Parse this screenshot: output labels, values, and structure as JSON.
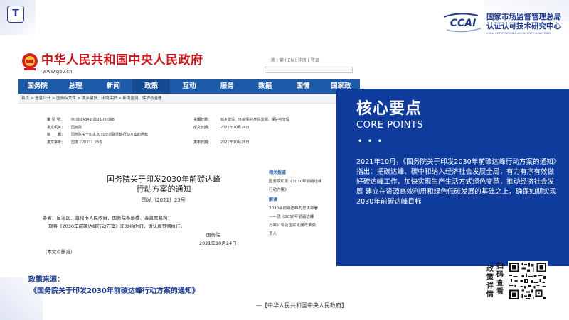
{
  "logo": {
    "mark": "CCAI",
    "name_line1": "国家市场监督管理总局",
    "name_line2": "认证认可技术研究中心",
    "name_en": "CHINA CERTIFICATION & ACCREDITATION INSTITUTE"
  },
  "corner_icon": "T",
  "gov": {
    "title": "中华人民共和国中央人民政府",
    "url": "www.gov.cn",
    "links": "简 | 繁 | EN | 注册 | 登录",
    "nav": [
      "国务院",
      "总理",
      "新闻",
      "政策",
      "互动",
      "服务",
      "数据",
      "国情",
      "国家政"
    ],
    "breadcrumb": "首页 > 信息公开 > 国务院文件 > 城乡建设、环境保护 > 环境监测、保护与治理",
    "meta": [
      {
        "k1": "索 引 号：",
        "v1": "000014349/2021-00098",
        "k2": "主题分类：",
        "v2": "城乡建设、环境保护\\环境监测、保护与治理"
      },
      {
        "k1": "发文机关：",
        "v1": "国务院",
        "k2": "成文日期：",
        "v2": "2021年10月24日"
      },
      {
        "k1": "标　　题：",
        "v1": "国务院关于印发2030年前碳达峰行动方案的通知",
        "k2": "",
        "v2": ""
      },
      {
        "k1": "发文字号：",
        "v1": "国发〔2021〕23号",
        "k2": "发布日期：",
        "v2": "2021年10月26日"
      }
    ],
    "doc_title_1": "国务院关于印发2030年前碳达峰",
    "doc_title_2": "行动方案的通知",
    "doc_number": "国发〔2021〕23号",
    "body_1": "各省、自治区、直辖市人民政府，国务院各部委、各直属机构：",
    "body_2": "现将《2030年前碳达峰行动方案》印发给你们，请认真贯彻执行。",
    "signer": "国务院",
    "date": "2021年10月24日",
    "note": "（本文有删减）",
    "side_related": "相关报道",
    "side_r1": "国务院印发《2030年前碳达峰",
    "side_r2": "行动方案》",
    "side_interpret": "解读",
    "side_i1": "2030年前碳达峰的总体部署",
    "side_i2": "——就《2030年前碳达峰",
    "side_i3": "方案》专访国家发展改革委",
    "side_i4": "责人"
  },
  "panel": {
    "title": "核心要点",
    "subtitle": "CORE POINTS",
    "dots": "• • •",
    "body": "2021年10月，《国务院关于印发2030年前碳达峰行动方案的通知》指出：把碳达峰、碳中和纳入经济社会发展全局，有力有序有效做好碳达峰工作，加快实现生产生活方式绿色变革，推动经济社会发展 建立在资源高效利用和绿色低碳发展的基础之上，确保如期实现 2030年前碳达峰目标"
  },
  "footer": {
    "source_label": "政策来源：",
    "source_link": "《国务院关于印发2030年前碳达峰行动方案的通知》",
    "source_name": "—【中华人民共和国中央人民政府】",
    "scan_col1": "政策详情",
    "scan_col2": "扫码查看"
  },
  "colors": {
    "panel_blue": "#0f3b9c",
    "gov_red": "#c8161d",
    "nav_blue": "#1d5aa8",
    "source_blue": "#1a3a8f"
  }
}
